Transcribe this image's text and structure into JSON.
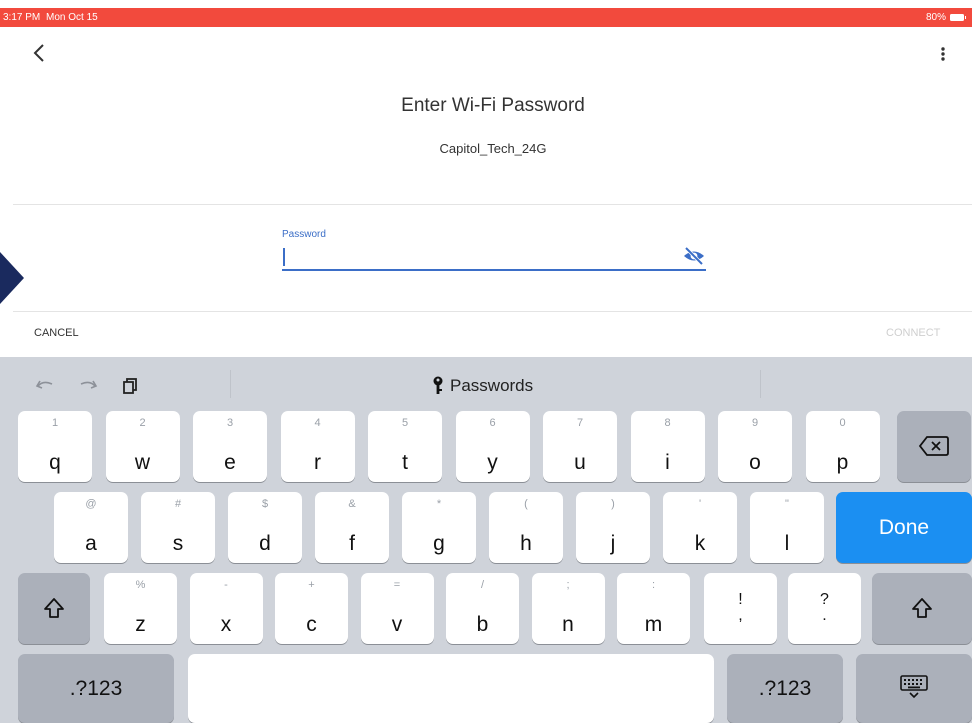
{
  "status_bar": {
    "time": "3:17 PM",
    "date": "Mon Oct 15",
    "battery": "80%"
  },
  "dialog": {
    "title": "Enter Wi-Fi Password",
    "network_name": "Capitol_Tech_24G",
    "password_label": "Password",
    "password_value": "",
    "cancel_label": "CANCEL",
    "connect_label": "CONNECT"
  },
  "keyboard": {
    "toolbar_label": "Passwords",
    "row1": [
      {
        "hint": "1",
        "key": "q"
      },
      {
        "hint": "2",
        "key": "w"
      },
      {
        "hint": "3",
        "key": "e"
      },
      {
        "hint": "4",
        "key": "r"
      },
      {
        "hint": "5",
        "key": "t"
      },
      {
        "hint": "6",
        "key": "y"
      },
      {
        "hint": "7",
        "key": "u"
      },
      {
        "hint": "8",
        "key": "i"
      },
      {
        "hint": "9",
        "key": "o"
      },
      {
        "hint": "0",
        "key": "p"
      }
    ],
    "row2": [
      {
        "hint": "@",
        "key": "a"
      },
      {
        "hint": "#",
        "key": "s"
      },
      {
        "hint": "$",
        "key": "d"
      },
      {
        "hint": "&",
        "key": "f"
      },
      {
        "hint": "*",
        "key": "g"
      },
      {
        "hint": "(",
        "key": "h"
      },
      {
        "hint": ")",
        "key": "j"
      },
      {
        "hint": "'",
        "key": "k"
      },
      {
        "hint": "\"",
        "key": "l"
      }
    ],
    "row3": [
      {
        "hint": "%",
        "key": "z"
      },
      {
        "hint": "-",
        "key": "x"
      },
      {
        "hint": "+",
        "key": "c"
      },
      {
        "hint": "=",
        "key": "v"
      },
      {
        "hint": "/",
        "key": "b"
      },
      {
        "hint": ";",
        "key": "n"
      },
      {
        "hint": ":",
        "key": "m"
      }
    ],
    "row3_punct": [
      {
        "top": "!",
        "bottom": ","
      },
      {
        "top": "?",
        "bottom": "."
      }
    ],
    "done_label": "Done",
    "numbers_label": ".?123"
  }
}
